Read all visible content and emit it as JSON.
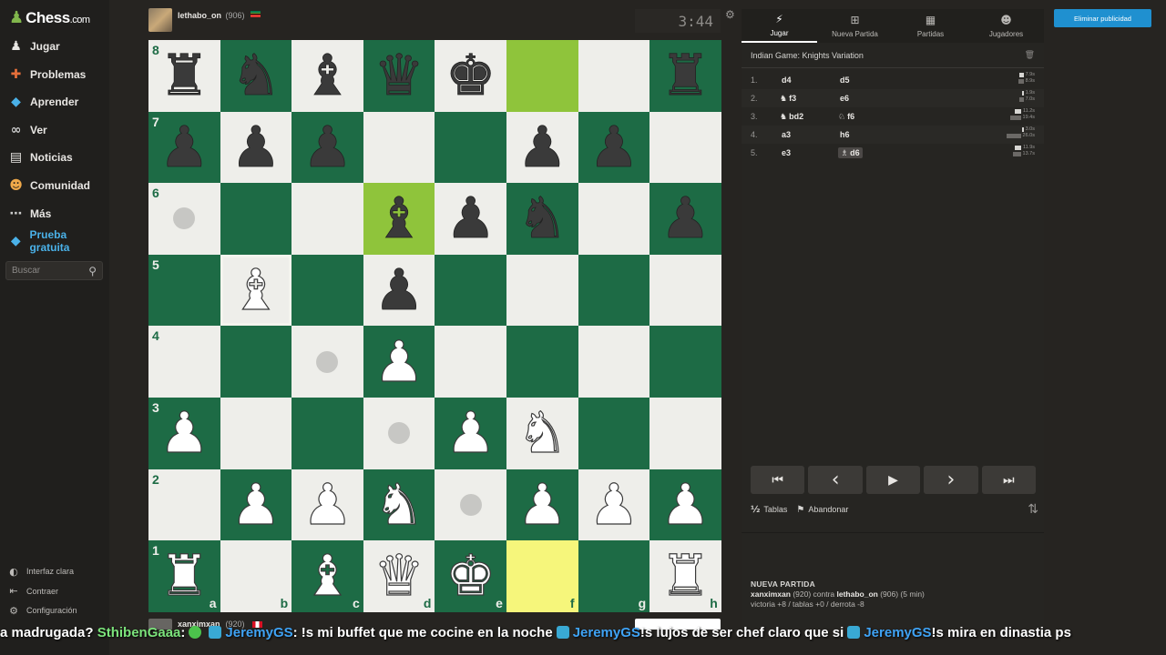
{
  "logo": {
    "name": "Chess",
    "suffix": ".com"
  },
  "nav": [
    {
      "label": "Jugar",
      "icon": "play-icon"
    },
    {
      "label": "Problemas",
      "icon": "puzzle-icon"
    },
    {
      "label": "Aprender",
      "icon": "learn-icon"
    },
    {
      "label": "Ver",
      "icon": "binoculars-icon"
    },
    {
      "label": "Noticias",
      "icon": "news-icon"
    },
    {
      "label": "Comunidad",
      "icon": "community-icon"
    },
    {
      "label": "Más",
      "icon": "more-icon"
    },
    {
      "label": "Prueba gratuita",
      "icon": "diamond-icon"
    }
  ],
  "search": {
    "placeholder": "Buscar"
  },
  "bottom_nav": [
    {
      "label": "Interfaz clara",
      "icon": "contrast-icon"
    },
    {
      "label": "Contraer",
      "icon": "collapse-icon"
    },
    {
      "label": "Configuración",
      "icon": "gear-icon"
    }
  ],
  "top_player": {
    "name": "lethabo_on",
    "rating": "(906)",
    "clock": "3:44"
  },
  "bottom_player": {
    "name": "xanximxan",
    "rating": "(920)"
  },
  "board": {
    "ranks": [
      "8",
      "7",
      "6",
      "5",
      "4",
      "3",
      "2",
      "1"
    ],
    "files": [
      "a",
      "b",
      "c",
      "d",
      "e",
      "f",
      "g",
      "h"
    ],
    "position": [
      [
        "br",
        "bn",
        "bb",
        "bq",
        "bk",
        "",
        "",
        "br"
      ],
      [
        "bp",
        "bp",
        "bp",
        "",
        "",
        "bp",
        "bp",
        ""
      ],
      [
        "",
        "",
        "",
        "bb",
        "bp",
        "bn",
        "",
        "bp"
      ],
      [
        "",
        "wb",
        "",
        "bp",
        "",
        "",
        "",
        ""
      ],
      [
        "",
        "",
        "",
        "wp",
        "",
        "",
        "",
        ""
      ],
      [
        "wp",
        "",
        "",
        "",
        "wp",
        "wn",
        "",
        ""
      ],
      [
        "",
        "wp",
        "wp",
        "wn",
        "",
        "wp",
        "wp",
        "wp"
      ],
      [
        "wr",
        "",
        "wb",
        "wq",
        "wk",
        "",
        "",
        "wr"
      ]
    ],
    "highlights": [
      [
        0,
        5
      ],
      [
        2,
        3
      ],
      [
        7,
        5
      ]
    ],
    "selected": [
      3,
      1
    ],
    "move_dots": [
      [
        2,
        0
      ],
      [
        4,
        2
      ],
      [
        5,
        3
      ],
      [
        6,
        4
      ]
    ]
  },
  "tabs": [
    {
      "label": "Jugar",
      "icon": "bolt-icon"
    },
    {
      "label": "Nueva Partida",
      "icon": "plus-icon"
    },
    {
      "label": "Partidas",
      "icon": "board-icon"
    },
    {
      "label": "Jugadores",
      "icon": "players-icon"
    }
  ],
  "opening": "Indian Game: Knights Variation",
  "moves": [
    {
      "num": "1.",
      "white": "d4",
      "black": "d5",
      "wt": "7.9s",
      "bt": "8.9s",
      "wfig": "",
      "bfig": ""
    },
    {
      "num": "2.",
      "white": "f3",
      "black": "e6",
      "wt": "1.9s",
      "bt": "7.0s",
      "wfig": "♞",
      "bfig": ""
    },
    {
      "num": "3.",
      "white": "bd2",
      "black": "f6",
      "wt": "11.2s",
      "bt": "19.4s",
      "wfig": "♞",
      "bfig": "♘"
    },
    {
      "num": "4.",
      "white": "a3",
      "black": "h6",
      "wt": "3.0s",
      "bt": "26.0s",
      "wfig": "",
      "bfig": ""
    },
    {
      "num": "5.",
      "white": "e3",
      "black": "d6",
      "wt": "11.9s",
      "bt": "13.7s",
      "wfig": "",
      "bfig": "♗"
    }
  ],
  "controls": [
    "first-move-button",
    "prev-move-button",
    "play-button",
    "next-move-button",
    "last-move-button"
  ],
  "actions": {
    "draw": "Tablas",
    "draw_icon": "½",
    "resign": "Abandonar"
  },
  "new_game": {
    "heading": "NUEVA PARTIDA",
    "p1": "xanximxan",
    "p1_rating": " (920) contra ",
    "p2": "lethabo_on",
    "p2_rating": " (906) (5 min)",
    "record": "victoria +8 / tablas +0 / derrota -8"
  },
  "ad_button": "Eliminar publicidad",
  "ticker": {
    "t1": "a madrugada?",
    "u1": "SthibenGaaa",
    "t2": " : ",
    "u2": "JeremyGS",
    "t3": " : !s mi buffet que me cocine en la noche ",
    "u3": "JeremyGS",
    "t4": " !s lujos de ser chef claro que si ",
    "u4": "JeremyGS",
    "t5": " !s mira en dinastia ps"
  }
}
